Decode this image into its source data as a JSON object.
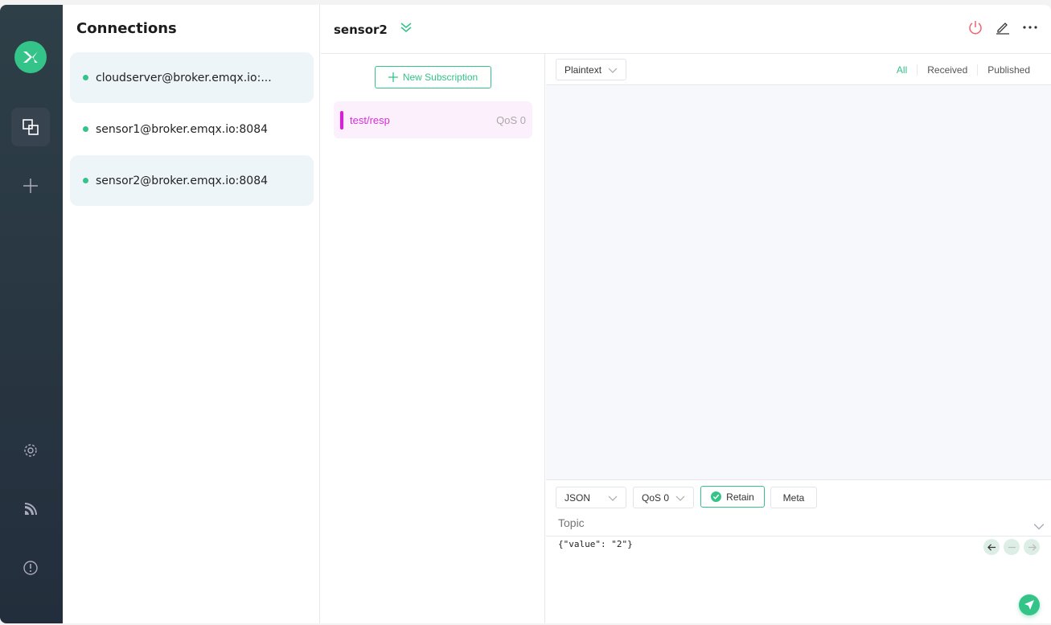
{
  "sidebar": {
    "nav": [
      "connections-icon",
      "new-connection-icon",
      "settings-icon",
      "subscribe-icon",
      "about-icon"
    ]
  },
  "connections": {
    "title": "Connections",
    "items": [
      {
        "label": "cloudserver@broker.emqx.io:...",
        "status": "connected",
        "selected": true
      },
      {
        "label": "sensor1@broker.emqx.io:8084",
        "status": "connected",
        "selected": false
      },
      {
        "label": "sensor2@broker.emqx.io:8084",
        "status": "connected",
        "selected": true
      }
    ]
  },
  "header": {
    "title": "sensor2"
  },
  "subscriptions": {
    "new_label": "New Subscription",
    "items": [
      {
        "topic": "test/resp",
        "qos": "QoS 0",
        "color": "#e317e3"
      }
    ]
  },
  "messages": {
    "format": "Plaintext",
    "filters": [
      "All",
      "Received",
      "Published"
    ],
    "active_filter": "All"
  },
  "publish": {
    "payload_format": "JSON",
    "qos": "QoS 0",
    "retain_label": "Retain",
    "retain_checked": true,
    "meta_label": "Meta",
    "topic_placeholder": "Topic",
    "payload": "{\"value\": \"2\"}"
  },
  "colors": {
    "accent": "#34c388",
    "sidebar": "#2a3844",
    "topic": "#e317e3",
    "disconnect": "#f0656b"
  }
}
